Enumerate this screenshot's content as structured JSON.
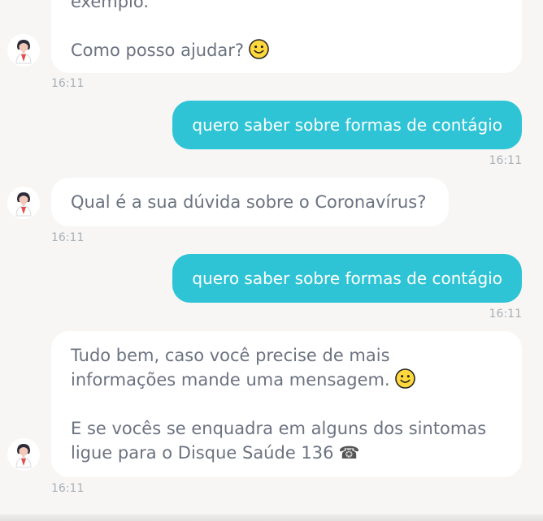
{
  "messages": [
    {
      "sender": "bot",
      "lines": [
        "exemplo.",
        "",
        "Como posso ajudar?"
      ],
      "emoji": "smiley-emoji",
      "time": "16:11"
    },
    {
      "sender": "user",
      "text": "quero saber sobre formas de contágio",
      "time": "16:11"
    },
    {
      "sender": "bot",
      "lines": [
        "Qual é a sua dúvida sobre o Coronavírus?"
      ],
      "time": "16:11"
    },
    {
      "sender": "user",
      "text": "quero saber sobre formas de contágio",
      "time": "16:11"
    },
    {
      "sender": "bot",
      "lines": [
        "Tudo bem, caso você precise de mais",
        "informações mande uma mensagem.",
        "",
        "E se vocês se enquadra em alguns dos sintomas",
        "ligue para o Disque Saúde 136"
      ],
      "emoji": "smiley-emoji",
      "trailing_icon": "☎",
      "time": "16:11"
    }
  ],
  "colors": {
    "background": "#f7f6f4",
    "user_bubble": "#2ec4d6",
    "bot_bubble": "#ffffff",
    "bot_text": "#6b7280",
    "timestamp": "#a9b0b8"
  }
}
